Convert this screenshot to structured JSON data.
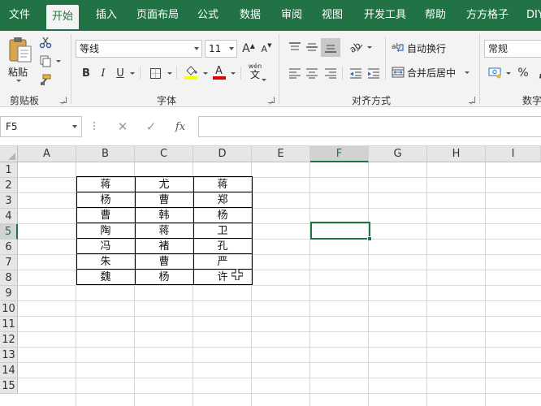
{
  "menu_tabs": [
    "文件",
    "开始",
    "插入",
    "页面布局",
    "公式",
    "数据",
    "审阅",
    "视图",
    "开发工具",
    "帮助",
    "方方格子",
    "DIY"
  ],
  "ribbon": {
    "clipboard": {
      "paste_label": "粘贴",
      "group_label": "剪贴板"
    },
    "font": {
      "font_name": "等线",
      "font_size": "11",
      "bold": "B",
      "italic": "I",
      "underline": "U",
      "increase_font": "A",
      "decrease_font": "A",
      "phonetic_top": "wén",
      "phonetic_char": "文",
      "font_color_letter": "A",
      "group_label": "字体",
      "highlight_color": "#ffff00",
      "font_color": "#ff0000"
    },
    "alignment": {
      "wrap_text": "自动换行",
      "merge_center": "合并后居中",
      "group_label": "对齐方式"
    },
    "number": {
      "format": "常规",
      "percent": "%",
      "comma": ",",
      "group_label": "数字"
    }
  },
  "formula_bar": {
    "name_box": "F5",
    "cancel": "✕",
    "enter": "✓",
    "fx": "fx",
    "value": ""
  },
  "columns": [
    "A",
    "B",
    "C",
    "D",
    "E",
    "F",
    "G",
    "H",
    "I"
  ],
  "selected_column": "F",
  "rows": [
    "1",
    "2",
    "3",
    "4",
    "5",
    "6",
    "7",
    "8",
    "9",
    "10",
    "11",
    "12",
    "13",
    "14",
    "15"
  ],
  "selected_row": "5",
  "table": [
    [
      "蒋",
      "尤",
      "蒋"
    ],
    [
      "杨",
      "曹",
      "郑"
    ],
    [
      "曹",
      "韩",
      "杨"
    ],
    [
      "陶",
      "蒋",
      "卫"
    ],
    [
      "冯",
      "褚",
      "孔"
    ],
    [
      "朱",
      "曹",
      "严"
    ],
    [
      "魏",
      "杨",
      "许"
    ]
  ],
  "colors": {
    "brand": "#217346",
    "ribbon_bg": "#f3f3f3"
  }
}
